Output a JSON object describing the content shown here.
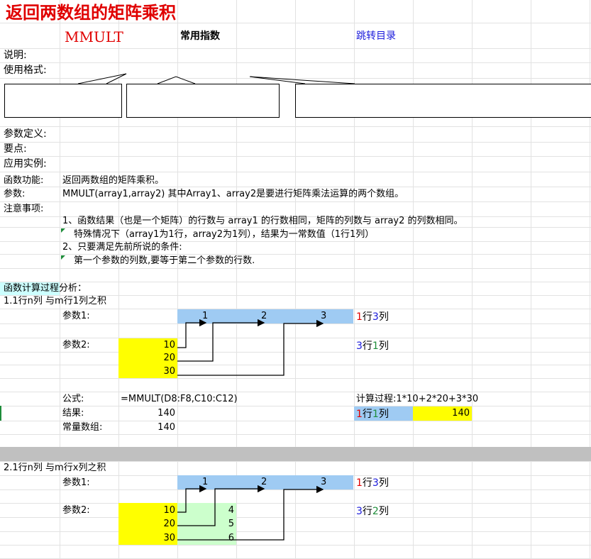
{
  "title": "返回两数组的矩阵乘积",
  "header": {
    "func_name": "MMULT",
    "category": "常用指数",
    "link": "跳转目录"
  },
  "labels": {
    "desc": "说明:",
    "format": "使用格式:",
    "params_def": "参数定义:",
    "key_points": "要点:",
    "examples": "应用实例:"
  },
  "info": {
    "func_label": "函数功能:",
    "func_value": "返回两数组的矩阵乘积。",
    "param_label": "参数:",
    "param_value": "MMULT(array1,array2)  其中Array1、array2是要进行矩阵乘法运算的两个数组。",
    "note_label": "注意事项:",
    "note1": "1、函数结果（也是一个矩阵）的行数与 array1 的行数相同，矩阵的列数与 array2 的列数相同。",
    "note1b": "特殊情况下（array1为1行，array2为1列），结果为一常数值（1行1列）",
    "note2": "2、只要满足先前所说的条件:",
    "note2b": "第一个参数的列数,要等于第二个参数的行数."
  },
  "analysis": {
    "heading": "函数计算过程分析：",
    "sec1_title": "1.1行n列 与m行1列之积",
    "param1": "参数1:",
    "param2": "参数2:",
    "array1": [
      "1",
      "2",
      "3"
    ],
    "array2": [
      "10",
      "20",
      "30"
    ],
    "dim1_a": "1",
    "dim1_b": "行",
    "dim1_c": "3",
    "dim1_d": "列",
    "dim2_a": "3",
    "dim2_b": "行",
    "dim2_c": "1",
    "dim2_d": "列",
    "formula_label": "公式:",
    "formula": "=MMULT(D8:F8,C10:C12)",
    "calc_label": "计算过程:1*10+2*20+3*30",
    "result_label": "结果:",
    "result_value": "140",
    "res_dim_a": "1",
    "res_dim_b": "行",
    "res_dim_c": "1",
    "res_dim_d": "列",
    "res_dim_value": "140",
    "const_label": "常量数组:",
    "const_value": "140",
    "sec2_title": "2.1行n列 与m行x列之积",
    "array2b_col1": [
      "10",
      "20",
      "30"
    ],
    "array2b_col2": [
      "4",
      "5",
      "6"
    ],
    "dim3_a": "1",
    "dim3_b": "行",
    "dim3_c": "3",
    "dim3_d": "列",
    "dim4_a": "3",
    "dim4_b": "行",
    "dim4_c": "2",
    "dim4_d": "列"
  },
  "colors": {
    "title_red": "#e00000",
    "link_blue": "#1a1adb",
    "light_blue_fill": "#9fcbf3",
    "yellow_fill": "#ffff00",
    "green_fill": "#ccffcc",
    "cyan_fill": "#ccffff",
    "separator_gray": "#c0c0c0"
  }
}
